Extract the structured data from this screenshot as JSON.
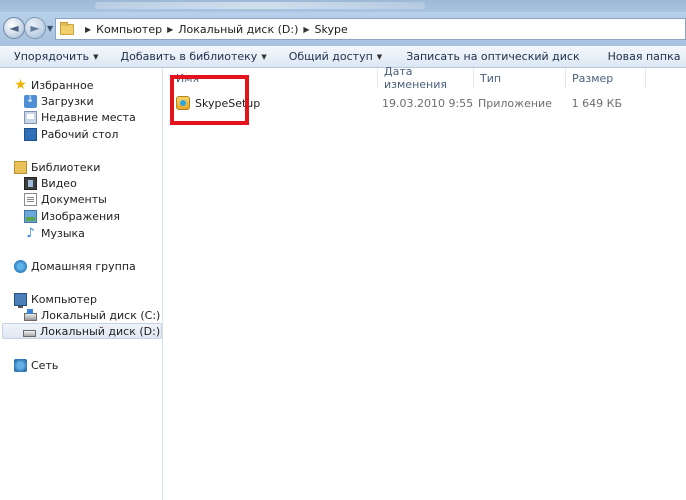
{
  "address": {
    "crumbs": [
      "Компьютер",
      "Локальный диск (D:)",
      "Skype"
    ]
  },
  "toolbar": {
    "organize": "Упорядочить",
    "add_to_library": "Добавить в библиотеку",
    "share": "Общий доступ",
    "burn": "Записать на оптический диск",
    "new_folder": "Новая папка"
  },
  "sidebar": {
    "favorites": {
      "label": "Избранное",
      "items": [
        "Загрузки",
        "Недавние места",
        "Рабочий стол"
      ]
    },
    "libraries": {
      "label": "Библиотеки",
      "items": [
        "Видео",
        "Документы",
        "Изображения",
        "Музыка"
      ]
    },
    "homegroup": "Домашняя группа",
    "computer": {
      "label": "Компьютер",
      "items": [
        "Локальный диск (C:)",
        "Локальный диск (D:)"
      ]
    },
    "network": "Сеть"
  },
  "columns": {
    "name": "Имя",
    "date": "Дата изменения",
    "type": "Тип",
    "size": "Размер"
  },
  "files": [
    {
      "name": "SkypeSetup",
      "date": "19.03.2010 9:55",
      "type": "Приложение",
      "size": "1 649 КБ"
    }
  ],
  "colors": {
    "highlight": "#e3121b"
  }
}
